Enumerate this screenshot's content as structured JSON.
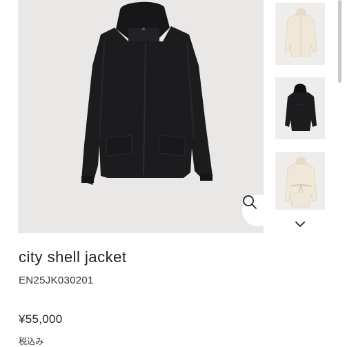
{
  "product": {
    "name": "city shell jacket",
    "code": "EN25JK030201",
    "price": "¥55,000",
    "tax_note": "税込み"
  },
  "gallery": {
    "main_image": "black hooded city shell jacket on grey background",
    "thumbnails": [
      {
        "color": "ivory",
        "view": "front"
      },
      {
        "color": "black",
        "view": "back"
      },
      {
        "color": "ivory",
        "view": "back belted"
      }
    ]
  },
  "icons": {
    "zoom": "search-icon",
    "more_thumbnails": "chevron-down-icon"
  },
  "colors": {
    "image_background": "#e9e8e6",
    "jacket_black": "#1c1c1e",
    "jacket_ivory": "#efe7d8",
    "text": "#1f1f1f"
  }
}
